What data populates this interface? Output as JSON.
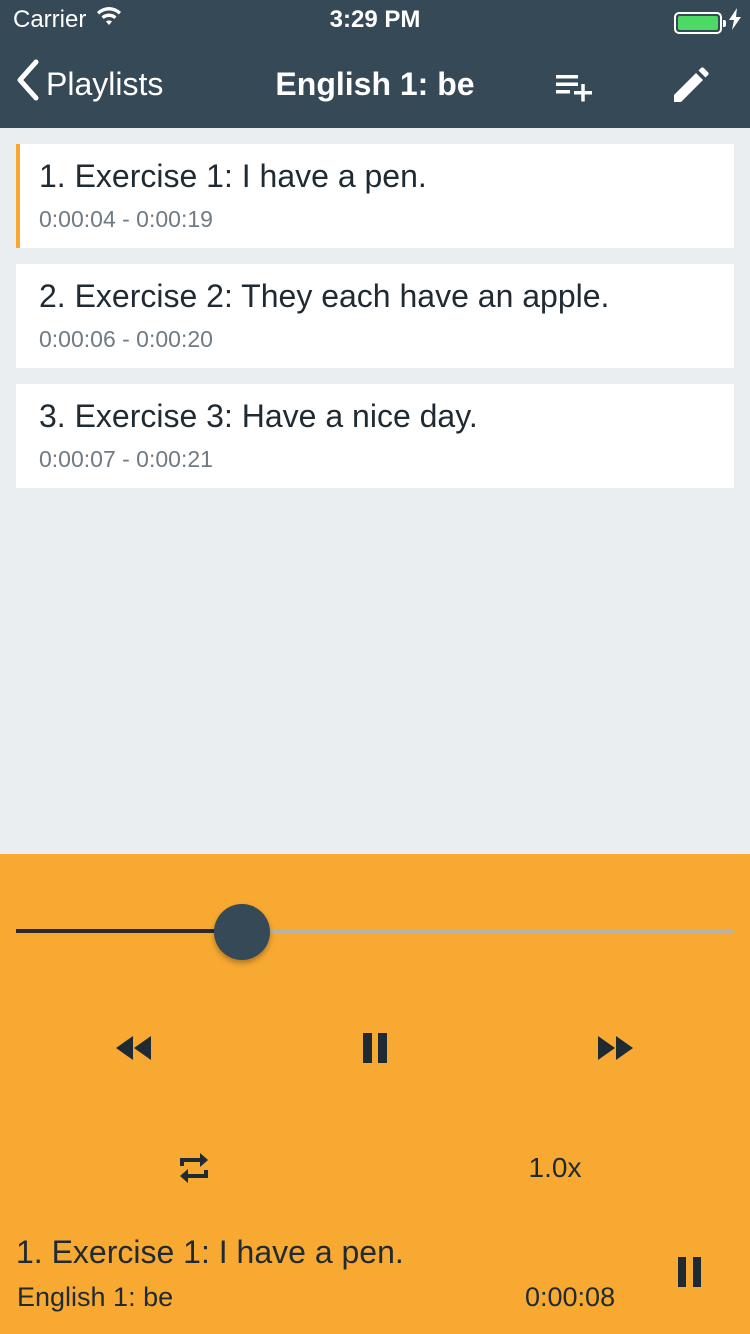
{
  "status": {
    "carrier": "Carrier",
    "time": "3:29 PM",
    "battery_color": "#4cd964"
  },
  "nav": {
    "back_label": "Playlists",
    "title": "English 1: be",
    "add_icon": "playlist-add-icon",
    "edit_icon": "pencil-icon"
  },
  "tracks": [
    {
      "title": "1. Exercise 1: I have a pen.",
      "time": "0:00:04 - 0:00:19",
      "active": true
    },
    {
      "title": "2. Exercise 2: They each have an apple.",
      "time": "0:00:06 - 0:00:20",
      "active": false
    },
    {
      "title": "3. Exercise 3: Have a nice day.",
      "time": "0:00:07 - 0:00:21",
      "active": false
    }
  ],
  "player": {
    "progress": 0.315,
    "speed": "1.0x",
    "now_playing_title": "1. Exercise 1: I have a pen.",
    "now_playing_playlist": "English 1: be",
    "elapsed": "0:00:08",
    "accent": "#f8a932",
    "bar_color": "#364957"
  }
}
